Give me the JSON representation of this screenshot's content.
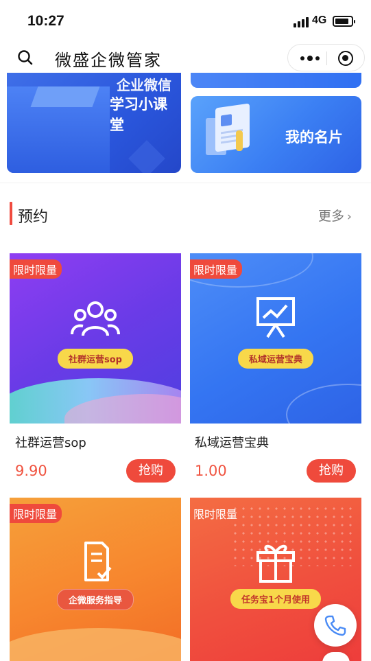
{
  "status_bar": {
    "time": "10:27",
    "network": "4G"
  },
  "nav": {
    "title": "微盛企微管家"
  },
  "banners": {
    "left_line1": "企业微信",
    "left_line2": "学习小课堂",
    "right_label": "我的名片"
  },
  "section": {
    "title": "预约",
    "more": "更多"
  },
  "products": [
    {
      "badge": "限时限量",
      "tag": "社群运营sop",
      "name": "社群运营sop",
      "price": "9.90",
      "buy": "抢购",
      "icon": "community-icon"
    },
    {
      "badge": "限时限量",
      "tag": "私域运营宝典",
      "name": "私域运营宝典",
      "price": "1.00",
      "buy": "抢购",
      "icon": "chart-board-icon"
    },
    {
      "badge": "限时限量",
      "tag": "企微服务指导",
      "icon": "document-check-icon"
    },
    {
      "badge": "限时限量",
      "tag": "任务宝1个月使用",
      "icon": "gift-icon"
    }
  ],
  "colors": {
    "accent": "#ef4a3c",
    "price": "#f05340",
    "section_bar": "#f04b3f"
  }
}
